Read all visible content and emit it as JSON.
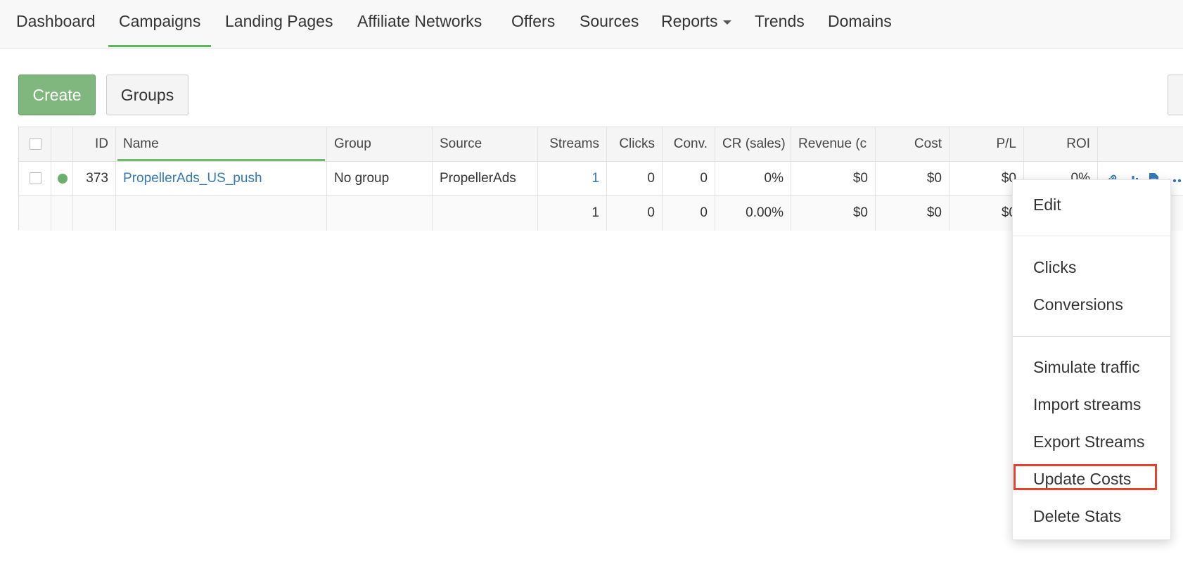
{
  "nav": {
    "items": [
      {
        "label": "Dashboard"
      },
      {
        "label": "Campaigns"
      },
      {
        "label": "Landing Pages"
      },
      {
        "label": "Affiliate Networks"
      },
      {
        "label": "Offers"
      },
      {
        "label": "Sources"
      },
      {
        "label": "Reports"
      },
      {
        "label": "Trends"
      },
      {
        "label": "Domains"
      }
    ],
    "active": "Campaigns"
  },
  "toolbar": {
    "create_label": "Create",
    "groups_label": "Groups"
  },
  "table": {
    "columns": [
      "ID",
      "Name",
      "Group",
      "Source",
      "Streams",
      "Clicks",
      "Conv.",
      "CR (sales)",
      "Revenue (c",
      "Cost",
      "P/L",
      "ROI"
    ],
    "rows": [
      {
        "id": "373",
        "name": "PropellerAds_US_push",
        "group": "No group",
        "source": "PropellerAds",
        "streams": "1",
        "clicks": "0",
        "conv": "0",
        "cr": "0%",
        "revenue": "$0",
        "cost": "$0",
        "pl": "$0",
        "roi": "0%"
      }
    ],
    "totals": {
      "streams": "1",
      "clicks": "0",
      "conv": "0",
      "cr": "0.00%",
      "revenue": "$0",
      "cost": "$0",
      "pl": "$0"
    }
  },
  "menu": {
    "items": [
      {
        "label": "Edit"
      },
      {
        "label": "Clicks"
      },
      {
        "label": "Conversions"
      },
      {
        "label": "Simulate traffic"
      },
      {
        "label": "Import streams"
      },
      {
        "label": "Export Streams"
      },
      {
        "label": "Update Costs"
      },
      {
        "label": "Delete Stats"
      }
    ]
  },
  "colors": {
    "accent_green": "#5cb85c",
    "link_blue": "#337ab7",
    "highlight_red": "#e2432a"
  }
}
